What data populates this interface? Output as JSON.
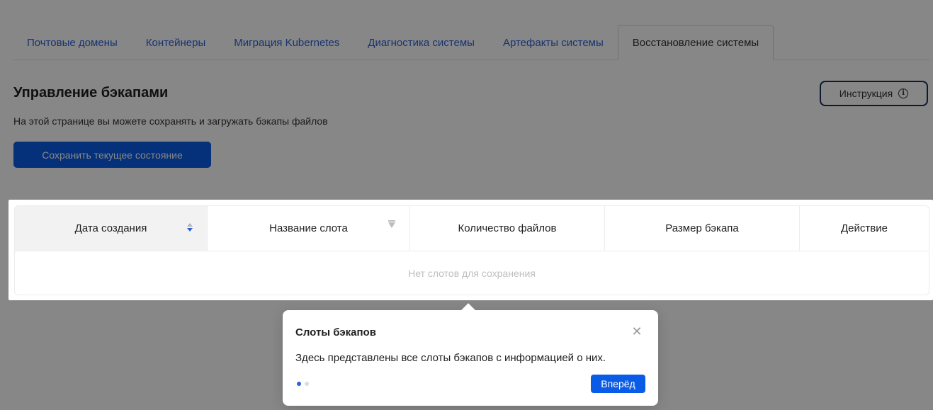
{
  "tabs": [
    {
      "label": "Почтовые домены",
      "active": false
    },
    {
      "label": "Контейнеры",
      "active": false
    },
    {
      "label": "Миграция Kubernetes",
      "active": false
    },
    {
      "label": "Диагностика системы",
      "active": false
    },
    {
      "label": "Артефакты системы",
      "active": false
    },
    {
      "label": "Восстановление системы",
      "active": true
    }
  ],
  "header": {
    "title": "Управление бэкапами",
    "description": "На этой странице вы можете сохранять и загружать бэкапы файлов",
    "save_button": "Сохранить текущее состояние",
    "instructions_button": "Инструкция",
    "instructions_icon": "info-icon"
  },
  "table": {
    "columns": [
      "Дата создания",
      "Название слота",
      "Количество файлов",
      "Размер бэкапа",
      "Действие"
    ],
    "empty_text": "Нет слотов для сохранения"
  },
  "popover": {
    "title": "Слоты бэкапов",
    "description": "Здесь представлены все слоты бэкапов с информацией о них.",
    "next_button": "Вперёд",
    "close_icon": "close-icon"
  },
  "colors": {
    "accent": "#0a5ce6",
    "link": "#2a62d8",
    "instruction_border": "#17305a"
  }
}
